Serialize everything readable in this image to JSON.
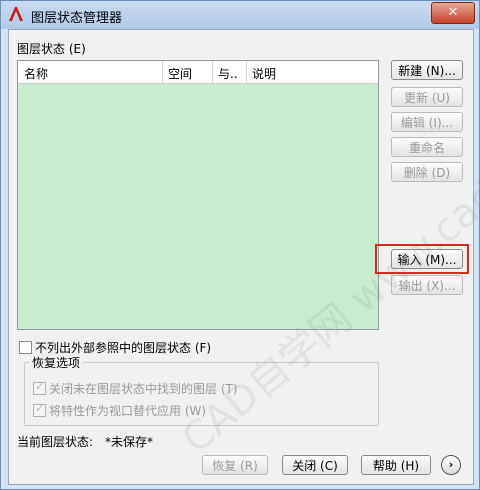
{
  "window": {
    "title": "图层状态管理器",
    "close_label": "✕"
  },
  "layer_states": {
    "group_label": "图层状态 (E)",
    "columns": [
      "名称",
      "空间",
      "与..",
      "说明"
    ],
    "rows": []
  },
  "buttons": {
    "new": "新建 (N)...",
    "update": "更新 (U)",
    "edit": "编辑 (I)...",
    "rename": "重命名",
    "delete": "删除 (D)",
    "import": "输入 (M)...",
    "export": "输出 (X)..."
  },
  "options": {
    "exclude_xref_label": "不列出外部参照中的图层状态 (F)",
    "exclude_xref_checked": false,
    "restore_group_title": "恢复选项",
    "turn_off_label": "关闭未在图层状态中找到的图层 (T)",
    "turn_off_checked": true,
    "viewport_override_label": "将特性作为视口替代应用 (W)",
    "viewport_override_checked": true
  },
  "status": {
    "label": "当前图层状态:",
    "value": "*未保存*"
  },
  "footer": {
    "restore": "恢复 (R)",
    "close": "关闭 (C)",
    "help": "帮助 (H)",
    "more": "›"
  },
  "watermark": "CAD自学网  www.cadzxw.com",
  "colors": {
    "list_bg": "#c9ecd1",
    "highlight": "#d9281c",
    "title_bar": "#b4cbe8"
  }
}
